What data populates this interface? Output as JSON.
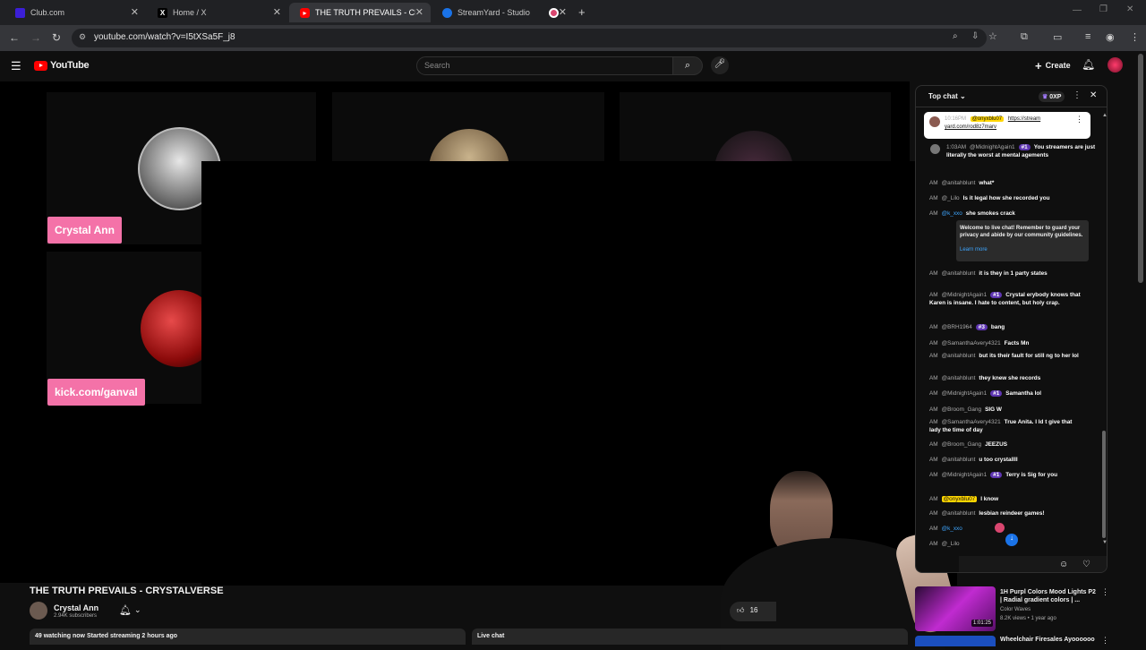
{
  "browser": {
    "tabs": [
      {
        "title": "Club.com",
        "favicon_color": "#3b1fd6",
        "active": false
      },
      {
        "title": "Home / X",
        "favicon_color": "#000000",
        "active": false
      },
      {
        "title": "THE TRUTH PREVAILS - CRYSTA",
        "favicon_color": "#ff0000",
        "active": true
      },
      {
        "title": "StreamYard - Studio",
        "favicon_color": "#1a73e8",
        "active": false
      },
      {
        "title": "",
        "favicon_color": "#d9466f",
        "active": false
      }
    ],
    "new_tab_label": "+",
    "url": "youtube.com/watch?v=I5tXSa5F_j8"
  },
  "youtube": {
    "logo_text": "YouTube",
    "search_placeholder": "Search",
    "create_label": "Create"
  },
  "video": {
    "plates": [
      "Crystal Ann",
      "kick.com/ganval"
    ],
    "title": "THE TRUTH PREVAILS - CRYSTALVERSE",
    "channel_name": "Crystal Ann",
    "subscribers": "2.94K subscribers",
    "likes": "16",
    "description_line": "49 watching now  Started streaming 2 hours ago",
    "live_chat_label": "Live chat"
  },
  "chat": {
    "header": "Top chat",
    "xp": "0XP",
    "pinned": {
      "time": "10:16PM",
      "user": "@onyxblu07",
      "text": "https://stream yard.com/rod8z7marv"
    },
    "messages": [
      {
        "time": "1:03AM",
        "user": "@MidnightAgain1",
        "badge": "#1",
        "text": "You streamers are just literally the worst at mental agements"
      },
      {
        "time": "AM",
        "user": "@anitahblunt",
        "text": "what*"
      },
      {
        "time": "AM",
        "user": "@_Lilo",
        "text": "Is it legal how she recorded you"
      },
      {
        "time": "AM",
        "user": "@k_xxo",
        "text": "she smokes crack"
      },
      {
        "time": "AM",
        "user": "@anitahblunt",
        "text": "it is they in 1 party states"
      },
      {
        "time": "AM",
        "user": "@MidnightAgain1",
        "badge": "#1",
        "text": "Crystal erybody knows that Karen is insane. I hate to content, but holy crap."
      },
      {
        "time": "AM",
        "user": "@BRH1964",
        "badge": "#3",
        "text": "bang"
      },
      {
        "time": "AM",
        "user": "@SamanthaAvery4321",
        "text": "Facts Mn"
      },
      {
        "time": "AM",
        "user": "@anitahblunt",
        "text": "but its their fault for still ng to her lol"
      },
      {
        "time": "AM",
        "user": "@anitahblunt",
        "text": "they knew she records"
      },
      {
        "time": "AM",
        "user": "@MidnightAgain1",
        "badge": "#1",
        "text": "Samantha lol"
      },
      {
        "time": "AM",
        "user": "@Broom_Gang",
        "text": "SIG W"
      },
      {
        "time": "AM",
        "user": "@SamanthaAvery4321",
        "text": "True Anita. I ld t give that lady the time of day"
      },
      {
        "time": "AM",
        "user": "@Broom_Gang",
        "text": "JEEZUS"
      },
      {
        "time": "AM",
        "user": "@anitahblunt",
        "text": "u too crystallll"
      },
      {
        "time": "AM",
        "user": "@MidnightAgain1",
        "badge": "#1",
        "text": "Terry is Sig for you"
      },
      {
        "time": "AM",
        "user": "@onyxblu07",
        "text": "I know"
      },
      {
        "time": "AM",
        "user": "@anitahblunt",
        "text": "lesbian reindeer games!"
      },
      {
        "time": "AM",
        "user": "@k_xxo",
        "text": ""
      },
      {
        "time": "AM",
        "user": "@_Lilo",
        "text": ""
      }
    ],
    "notice": "Welcome to live chat! Remember to guard your privacy and abide by our community guidelines.",
    "notice_link": "Learn more"
  },
  "recommendations": [
    {
      "title": "1H  Purpl Colors Mood Lights P2 | Radial gradient colors | ...",
      "channel": "Color Waves",
      "meta": "8.2K views • 1 year ago",
      "duration": "1:01:25"
    },
    {
      "title": "Wheelchair Firesales Ayoooooo",
      "channel": "",
      "meta": "",
      "duration": ""
    }
  ]
}
